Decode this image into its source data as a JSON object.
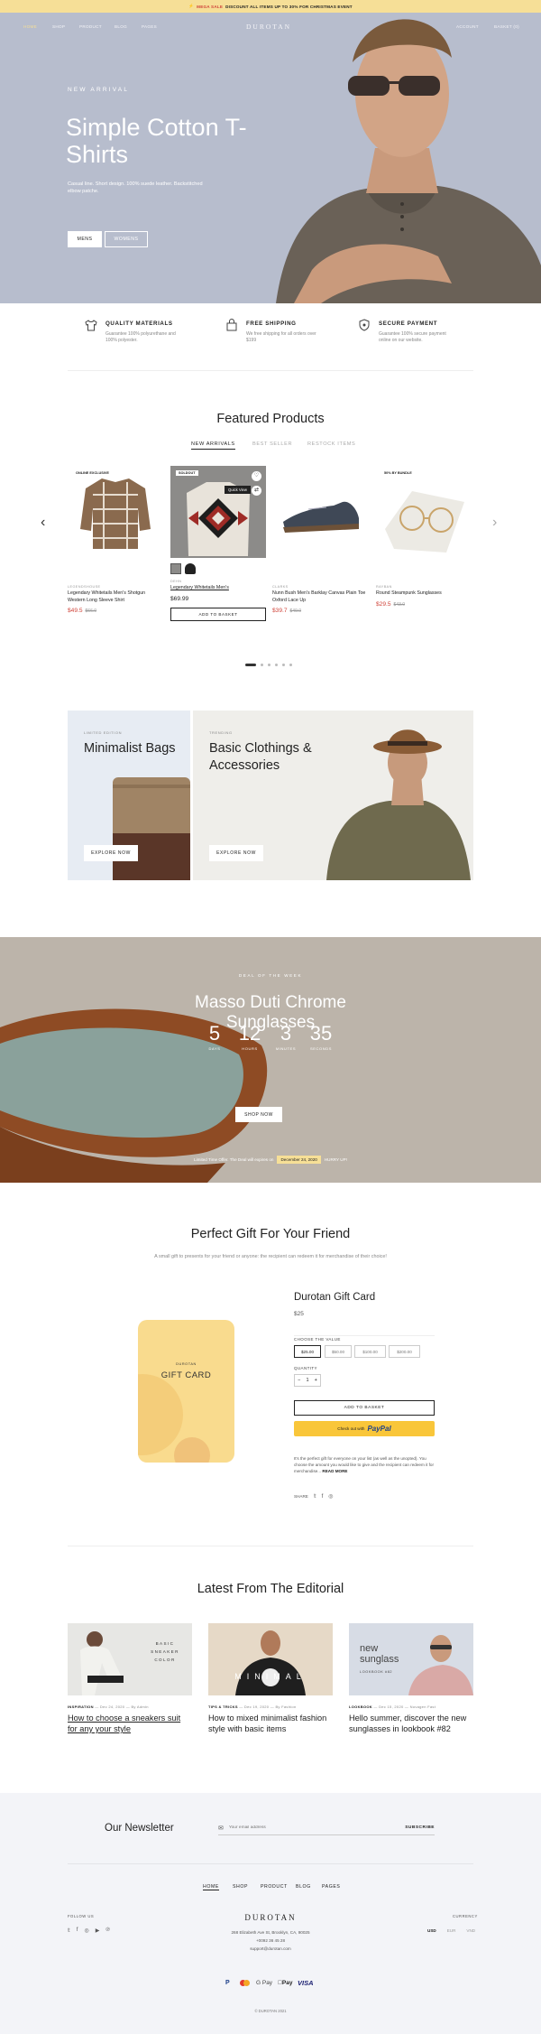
{
  "topbar": {
    "label": "MEGA SALE",
    "text": "DISCOUNT ALL ITEMS UP TO 30% FOR CHRISTMAS EVENT"
  },
  "nav": {
    "home": "HOME",
    "shop": "SHOP",
    "product": "PRODUCT",
    "blog": "BLOG",
    "pages": "PAGES",
    "logo": "DUROTAN",
    "account": "ACCOUNT",
    "basket": "BASKET (0)"
  },
  "hero": {
    "label": "NEW ARRIVAL",
    "title": "Simple Cotton T-Shirts",
    "text": "Casual line. Short design. 100% suede leather. Backstitched elbow patche.",
    "btn_mens": "MENS",
    "btn_womens": "WOMENS"
  },
  "features": [
    {
      "icon": "tshirt-icon",
      "title": "QUALITY MATERIALS",
      "desc": "Guarantee 100% polyurethane and 100% polyester."
    },
    {
      "icon": "bag-icon",
      "title": "FREE SHIPPING",
      "desc": "We free shipping for all orders over $199"
    },
    {
      "icon": "shield-icon",
      "title": "SECURE PAYMENT",
      "desc": "Guarantee 100% secure payment online on our website."
    }
  ],
  "featured": {
    "title": "Featured Products",
    "tabs": [
      "NEW ARRIVALS",
      "BEST SELLER",
      "RESTOCK ITEMS"
    ],
    "products": [
      {
        "badge": "ONLINE EXCLUSIVE",
        "cat": "LEGENDSHOUSE",
        "name": "Legendary Whitetails Men's Shotgun Western Long Sleeve Shirt",
        "price": "$49.5",
        "old": "$66.0"
      },
      {
        "badge": "SOLDOUT",
        "quick": "Quick View",
        "cat": "DEHN",
        "name": "Legendary Whitetails Men's",
        "price": "$69.99",
        "button": "ADD TO BASKET"
      },
      {
        "cat": "CLARKS",
        "name": "Nunn Bush Men's Barklay Canvas Plain Toe Oxford Lace Up",
        "price": "$39.7",
        "old": "$49.0"
      },
      {
        "badge": "50% BY BUNDLE",
        "cat": "RAYBAN",
        "name": "Round Steampunk Sunglasses",
        "price": "$29.5",
        "old": "$43.0"
      }
    ]
  },
  "banners": [
    {
      "label": "LIMITED EDITION",
      "title": "Minimalist Bags",
      "button": "EXPLORE NOW"
    },
    {
      "label": "TRENDING",
      "title": "Basic Clothings & Accessories",
      "button": "EXPLORE NOW"
    }
  ],
  "deal": {
    "label": "DEAL OF THE WEEK",
    "title": "Masso Duti Chrome Sunglasses",
    "countdown": [
      {
        "n": "5",
        "u": "DAYS"
      },
      {
        "n": "12",
        "u": "HOURS"
      },
      {
        "n": "3",
        "u": "MINUTES"
      },
      {
        "n": "35",
        "u": "SECONDS"
      }
    ],
    "button": "SHOP NOW",
    "offer_pre": "Limited Time Offer. The Deal will expires on",
    "offer_date": "December 24, 2020",
    "offer_post": "HURRY UP!"
  },
  "gift": {
    "title": "Perfect Gift For Your Friend",
    "subtitle": "A small gift to presents for your friend or anyone: the recipient can redeem it for merchandise of their choice!",
    "card_brand": "DUROTAN",
    "card_label": "GIFT CARD",
    "name": "Durotan Gift Card",
    "price": "$25",
    "choose": "CHOOSE THE VALUE",
    "values": [
      "$25.00",
      "$50.00",
      "$100.00",
      "$200.00"
    ],
    "quantity_label": "QUANTITY",
    "qty": "1",
    "minus": "−",
    "plus": "+",
    "add": "ADD TO BASKET",
    "paypal_pre": "Check out with",
    "paypal": "PayPal",
    "desc": "It's the perfect gift for everyone on your list (as well as the unopted). You choose the amount you would like to give and the recipient can redeem it for merchandise...",
    "read_more": "READ MORE",
    "share": "SHARE"
  },
  "editorial": {
    "title": "Latest From The Editorial",
    "posts": [
      {
        "overlay": "BASIC SNEAKER COLOR",
        "cat": "INSPIRATION",
        "date": "Dec 24, 2020",
        "author": "By Admin",
        "title": "How to choose a sneakers suit for any your style"
      },
      {
        "overlay": "MINIMAL",
        "cat": "TIPS & TRICKS",
        "date": "Dec 19, 2020",
        "author": "By Fashion",
        "title": "How to mixed minimalist fashion style with basic items"
      },
      {
        "overlay": "new sunglass",
        "overlay2": "LOOKBOOK #82",
        "cat": "LOOKBOOK",
        "date": "Dec 15, 2020",
        "author": "Nuvagen Fast",
        "title": "Hello summer, discover the new sunglasses in lookbook #82"
      }
    ]
  },
  "newsletter": {
    "title": "Our Newsletter",
    "placeholder": "Your email address",
    "button": "SUBSCRIBE"
  },
  "footer": {
    "nav": [
      "HOME",
      "SHOP",
      "PRODUCT",
      "BLOG",
      "PAGES"
    ],
    "follow": "FOLLOW US",
    "logo": "DUROTAN",
    "address": "268 Elizabeth Ave St, Brooklyn, CA, 90025",
    "phone": "+0092 36 45 28",
    "email": "support@durotan.com",
    "currency_label": "CURRENCY",
    "currencies": [
      "USD",
      "EUR",
      "VND"
    ],
    "payments": [
      "P",
      "MC",
      "G Pay",
      "Pay",
      "VISA"
    ],
    "copyright": "© DUROTAN 2021"
  },
  "colors": {
    "accent": "#d0443a",
    "topbar": "#f6df97",
    "hero": "#b7bdcd",
    "deal": "#bcb4aa",
    "gift": "#f9db8e",
    "paypal": "#f9c63a",
    "newsletter": "#f3f4f8"
  }
}
